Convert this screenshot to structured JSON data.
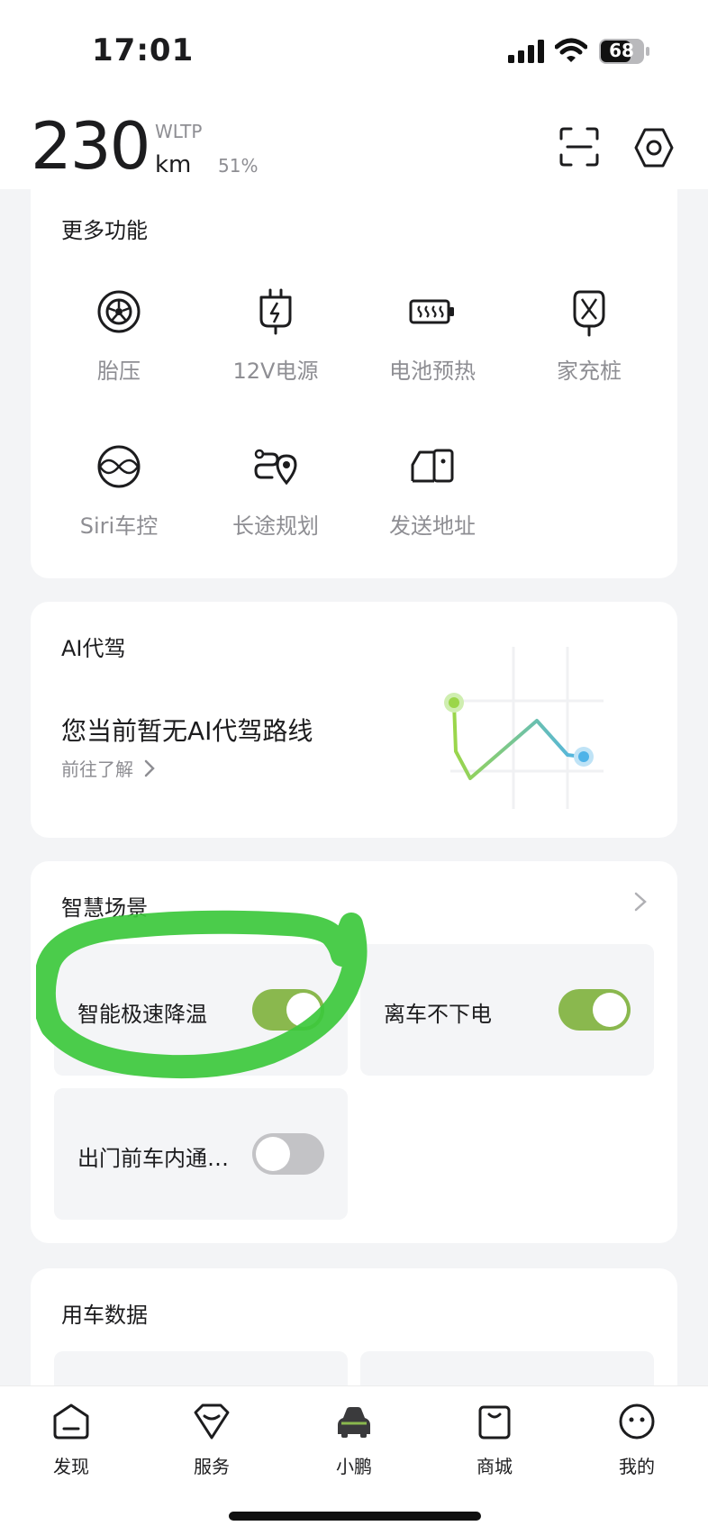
{
  "status_bar": {
    "time": "17:01",
    "battery": "68"
  },
  "header": {
    "range_value": "230",
    "range_standard": "WLTP",
    "range_unit": "km",
    "battery_percent": "51%"
  },
  "features": {
    "title": "更多功能",
    "items": [
      {
        "label": "胎压",
        "icon": "tire-icon"
      },
      {
        "label": "12V电源",
        "icon": "plug-icon"
      },
      {
        "label": "电池预热",
        "icon": "battery-heat-icon"
      },
      {
        "label": "家充桩",
        "icon": "charger-icon"
      },
      {
        "label": "Siri车控",
        "icon": "siri-icon"
      },
      {
        "label": "长途规划",
        "icon": "route-icon"
      },
      {
        "label": "发送地址",
        "icon": "send-address-icon"
      }
    ]
  },
  "ai_drive": {
    "title": "AI代驾",
    "headline": "您当前暂无AI代驾路线",
    "link": "前往了解"
  },
  "scenes": {
    "title": "智慧场景",
    "items": [
      {
        "label": "智能极速降温",
        "on": true
      },
      {
        "label": "离车不下电",
        "on": true
      },
      {
        "label": "出门前车内通…",
        "on": false
      }
    ]
  },
  "usage": {
    "title": "用车数据"
  },
  "tabbar": {
    "tabs": [
      {
        "label": "发现",
        "icon": "discover-icon"
      },
      {
        "label": "服务",
        "icon": "service-icon"
      },
      {
        "label": "小鹏",
        "icon": "car-icon"
      },
      {
        "label": "商城",
        "icon": "store-icon"
      },
      {
        "label": "我的",
        "icon": "profile-icon"
      }
    ]
  },
  "colors": {
    "accent_green": "#8ab84e",
    "marker_green": "#3cc83c",
    "toggle_off": "#c3c3c6"
  }
}
